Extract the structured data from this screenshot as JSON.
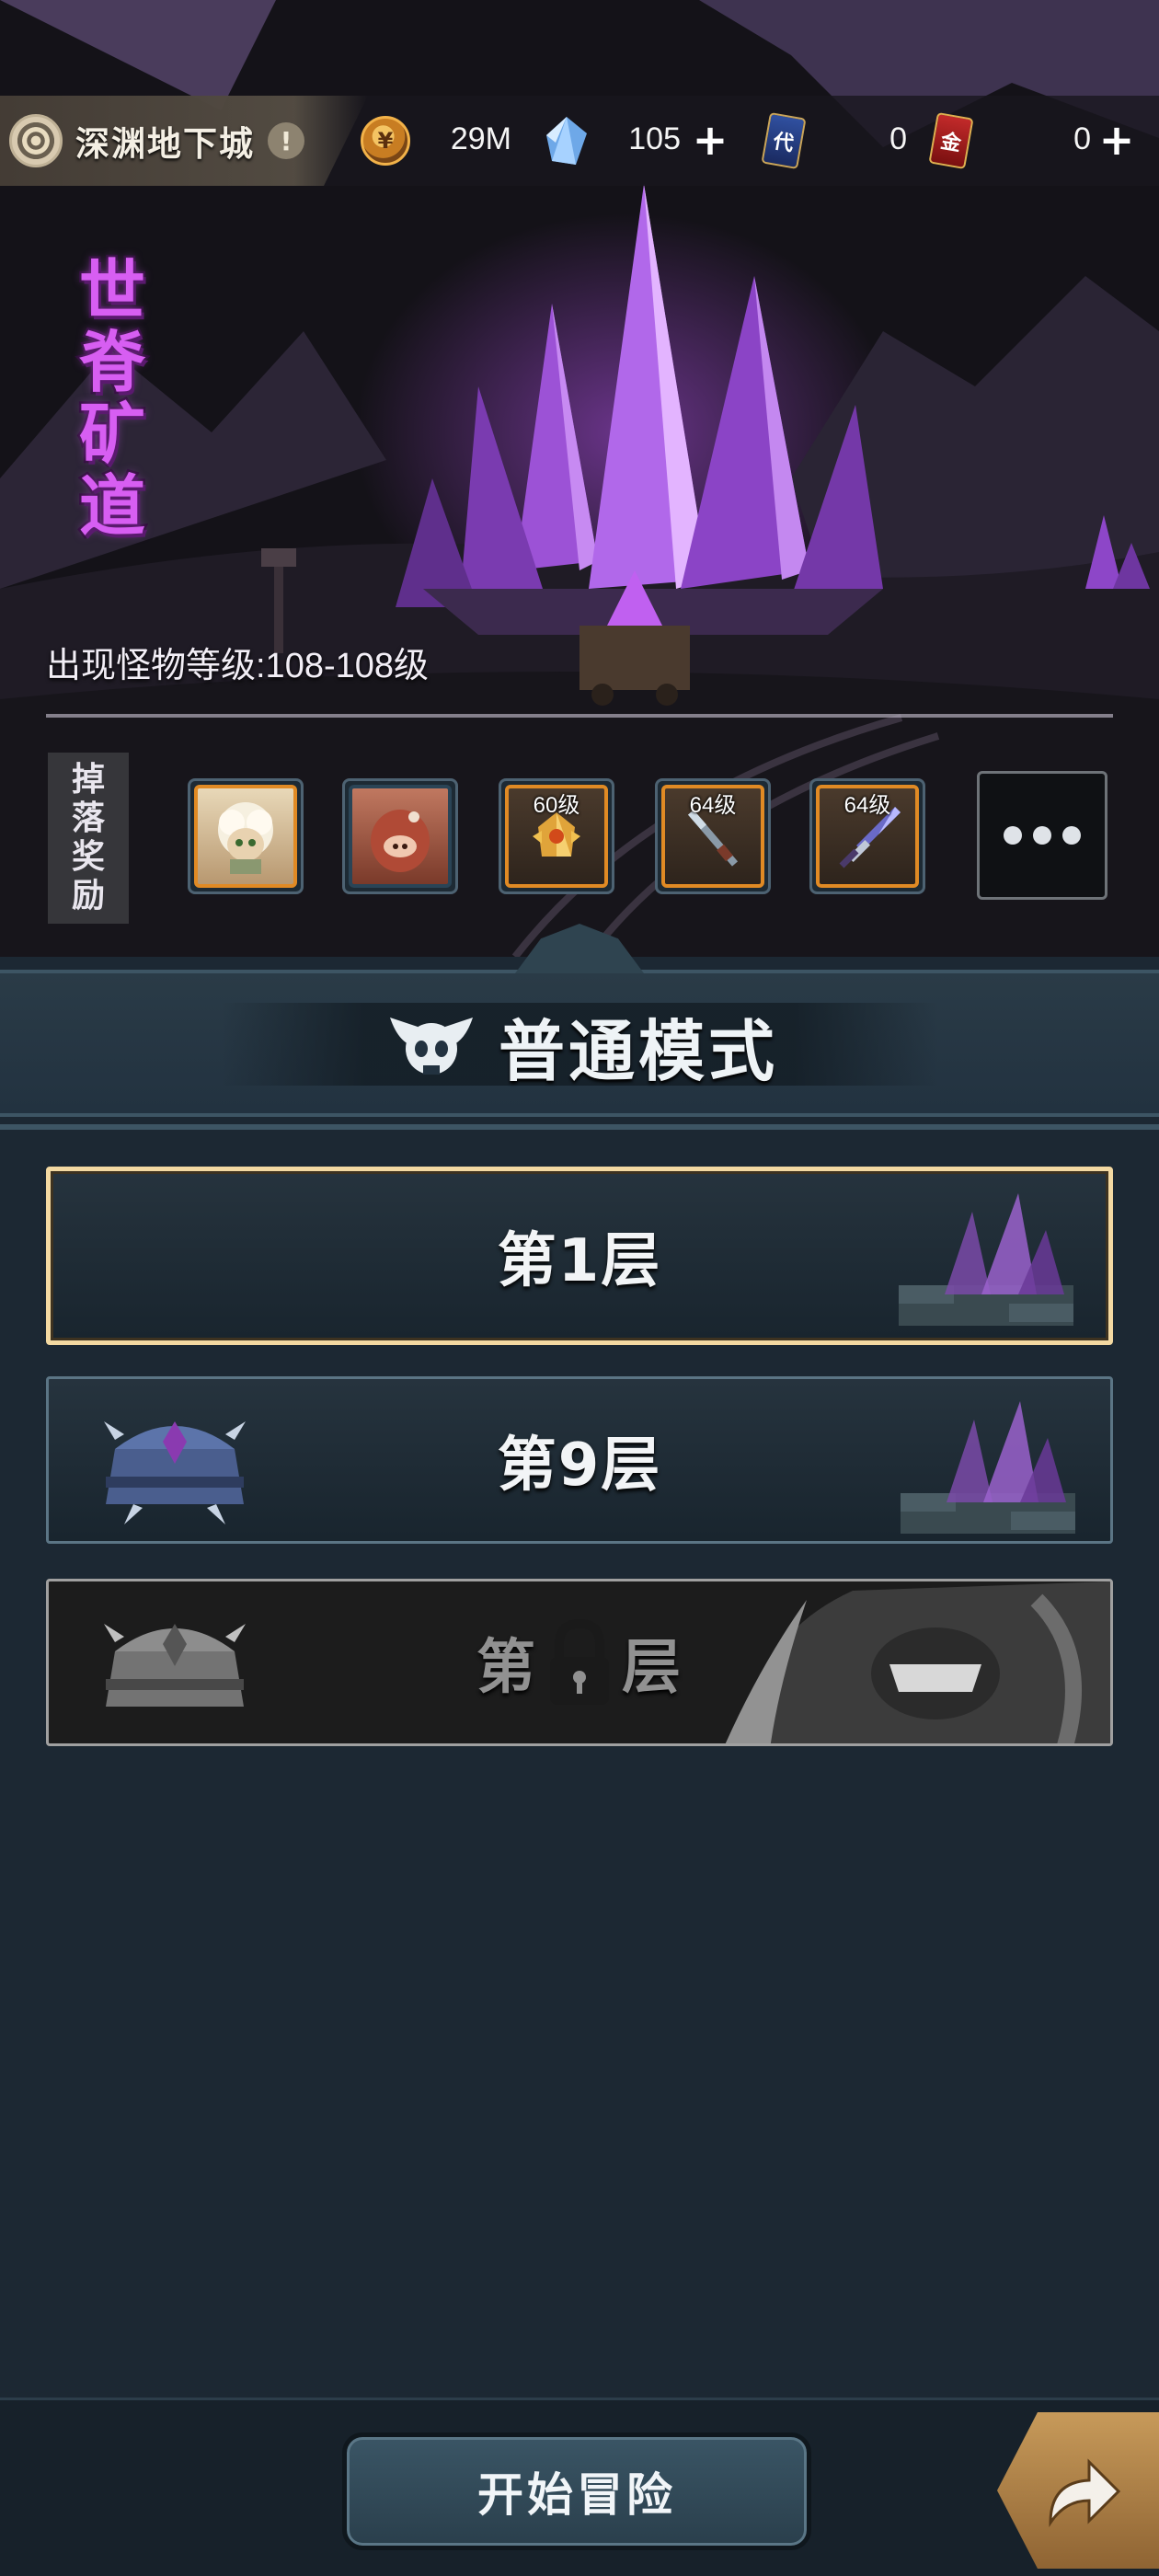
{
  "header": {
    "dungeon_title": "深渊地下城",
    "info_glyph": "!",
    "resources": [
      {
        "icon": "gold-coin-icon",
        "value": "29M",
        "has_plus": false
      },
      {
        "icon": "blue-crystal-icon",
        "value": "105",
        "has_plus": true
      },
      {
        "icon": "blue-card-icon",
        "value": "0",
        "has_plus": false
      },
      {
        "icon": "red-card-icon",
        "value": "0",
        "has_plus": true
      }
    ],
    "plus_glyph": "+",
    "blue_card_glyph": "代",
    "red_card_glyph": "金"
  },
  "stage": {
    "name_chars": [
      "世",
      "脊",
      "矿",
      "道"
    ],
    "monster_level": "出现怪物等级:108-108级"
  },
  "drops": {
    "label_chars": [
      "掉",
      "落",
      "奖",
      "励"
    ],
    "items": [
      {
        "icon": "sheep-hero-icon",
        "level": ""
      },
      {
        "icon": "red-creature-icon",
        "level": ""
      },
      {
        "icon": "golden-gauntlet-icon",
        "level": "60级"
      },
      {
        "icon": "spear-weapon-icon",
        "level": "64级"
      },
      {
        "icon": "purple-sword-icon",
        "level": "64级"
      }
    ]
  },
  "mode": {
    "title": "普通模式"
  },
  "floors": [
    {
      "label": "第1层",
      "selected": true,
      "locked": false
    },
    {
      "label": "第9层",
      "selected": false,
      "locked": false
    },
    {
      "label_prefix": "第",
      "label_suffix": "层",
      "selected": false,
      "locked": true
    }
  ],
  "footer": {
    "start_label": "开始冒险"
  },
  "colors": {
    "accent_purple": "#d75ef2",
    "panel_bg": "#1c2833",
    "selected_border": "#f3d9a2",
    "reward_border": "#e08a24"
  }
}
